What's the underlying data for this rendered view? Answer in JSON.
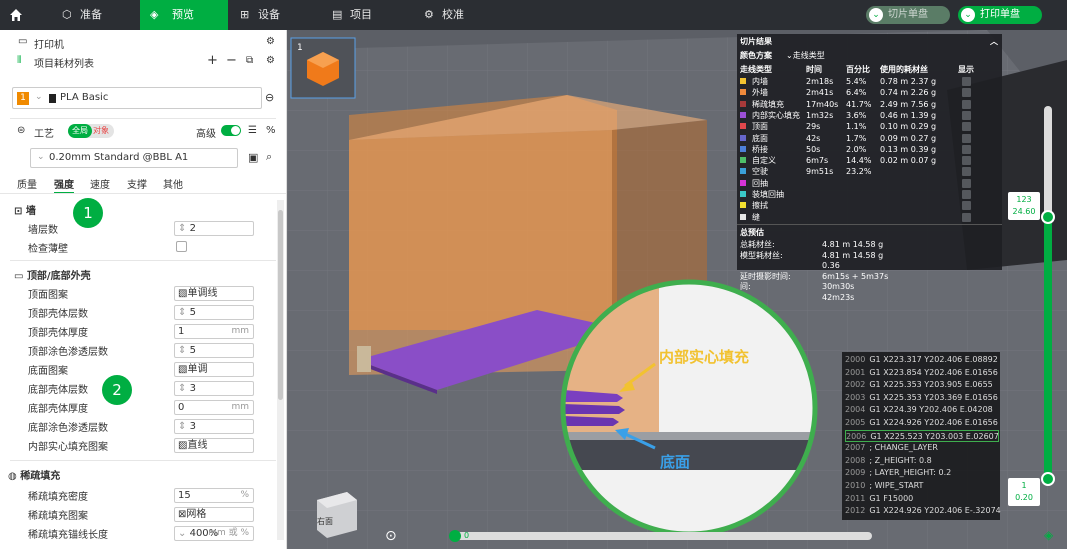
{
  "topbar": {
    "tabs": [
      "准备",
      "预览",
      "设备",
      "项目",
      "校准"
    ],
    "slice_plate": "切片单盘",
    "print_plate": "打印单盘"
  },
  "printer": {
    "label": "打印机",
    "filament_list": "项目耗材列表",
    "filament_slot": "1",
    "filament_name": "PLA Basic"
  },
  "process": {
    "label": "工艺",
    "tag_global": "全局",
    "tag_object": "对象",
    "advanced": "高级",
    "preset": "0.20mm Standard @BBL A1"
  },
  "settings_tabs": [
    "质量",
    "强度",
    "速度",
    "支撑",
    "其他"
  ],
  "sections": {
    "wall": "墙",
    "top_bottom": "顶部/底部外壳",
    "sparse": "稀疏填充"
  },
  "rows": [
    {
      "label": "墙层数",
      "value": "2",
      "unit": ""
    },
    {
      "label": "检查薄壁",
      "value": "",
      "unit": ""
    },
    {
      "label": "顶面图案",
      "value": "单调线",
      "unit": ""
    },
    {
      "label": "顶部壳体层数",
      "value": "5",
      "unit": ""
    },
    {
      "label": "顶部壳体厚度",
      "value": "1",
      "unit": "mm"
    },
    {
      "label": "顶部涂色渗透层数",
      "value": "5",
      "unit": ""
    },
    {
      "label": "底面图案",
      "value": "单调",
      "unit": ""
    },
    {
      "label": "底部壳体层数",
      "value": "3",
      "unit": ""
    },
    {
      "label": "底部壳体厚度",
      "value": "0",
      "unit": "mm"
    },
    {
      "label": "底部涂色渗透层数",
      "value": "3",
      "unit": ""
    },
    {
      "label": "内部实心填充图案",
      "value": "直线",
      "unit": ""
    },
    {
      "label": "稀疏填充密度",
      "value": "15",
      "unit": "%"
    },
    {
      "label": "稀疏填充图案",
      "value": "网格",
      "unit": ""
    },
    {
      "label": "稀疏填充锚线长度",
      "value": "400%",
      "unit": "mm 或 %"
    }
  ],
  "badges": [
    "1",
    "2"
  ],
  "slice_result": {
    "title": "切片结果",
    "scheme_label": "颜色方案",
    "scheme_value": "走线类型",
    "headers": [
      "走线类型",
      "时间",
      "百分比",
      "使用的耗材丝",
      "显示"
    ],
    "lines": [
      {
        "name": "内墙",
        "time": "2m18s",
        "pct": "5.4%",
        "fil": "0.78 m  2.37 g",
        "color": "#f2c230"
      },
      {
        "name": "外墙",
        "time": "2m41s",
        "pct": "6.4%",
        "fil": "0.74 m  2.26 g",
        "color": "#f08a3c"
      },
      {
        "name": "稀疏填充",
        "time": "17m40s",
        "pct": "41.7%",
        "fil": "2.49 m  7.56 g",
        "color": "#a83a3a"
      },
      {
        "name": "内部实心填充",
        "time": "1m32s",
        "pct": "3.6%",
        "fil": "0.46 m  1.39 g",
        "color": "#9b4fd6"
      },
      {
        "name": "顶面",
        "time": "29s",
        "pct": "1.1%",
        "fil": "0.10 m  0.29 g",
        "color": "#e0474c"
      },
      {
        "name": "底面",
        "time": "42s",
        "pct": "1.7%",
        "fil": "0.09 m  0.27 g",
        "color": "#6666cc"
      },
      {
        "name": "桥接",
        "time": "50s",
        "pct": "2.0%",
        "fil": "0.13 m  0.39 g",
        "color": "#4d80d9"
      },
      {
        "name": "自定义",
        "time": "6m7s",
        "pct": "14.4%",
        "fil": "0.02 m  0.07 g",
        "color": "#4fbf6a"
      },
      {
        "name": "空驶",
        "time": "9m51s",
        "pct": "23.2%",
        "fil": "",
        "color": "#3aa0d9"
      },
      {
        "name": "回抽",
        "time": "",
        "pct": "",
        "fil": "",
        "color": "#d633d6"
      },
      {
        "name": "装填回抽",
        "time": "",
        "pct": "",
        "fil": "",
        "color": "#3ac8c8"
      },
      {
        "name": "擦拭",
        "time": "",
        "pct": "",
        "fil": "",
        "color": "#f2e030"
      },
      {
        "name": "缝",
        "time": "",
        "pct": "",
        "fil": "",
        "color": "#e6e6e6"
      }
    ],
    "estimate_title": "总预估",
    "est_rows": [
      {
        "label": "总耗材丝:",
        "value": "4.81 m    14.58 g"
      },
      {
        "label": "模型耗材丝:",
        "value": "4.81 m    14.58 g"
      },
      {
        "label": "",
        "value": "0.36"
      },
      {
        "label": "延时摄影时间:",
        "value": "6m15s + 5m37s"
      },
      {
        "label": "间:",
        "value": "30m30s"
      },
      {
        "label": "",
        "value": "42m23s"
      }
    ]
  },
  "gcode": [
    {
      "n": "2000",
      "t": "G1 X223.317 Y202.406 E.08892"
    },
    {
      "n": "2001",
      "t": "G1 X223.854 Y202.406 E.01656"
    },
    {
      "n": "2002",
      "t": "G1 X225.353 Y203.905 E.0655"
    },
    {
      "n": "2003",
      "t": "G1 X225.353 Y203.369 E.01656"
    },
    {
      "n": "2004",
      "t": "G1 X224.39 Y202.406 E.04208"
    },
    {
      "n": "2005",
      "t": "G1 X224.926 Y202.406 E.01656"
    },
    {
      "n": "2006",
      "t": "G1 X225.523 Y203.003 E.02607"
    },
    {
      "n": "2007",
      "t": "; CHANGE_LAYER"
    },
    {
      "n": "2008",
      "t": "; Z_HEIGHT: 0.8"
    },
    {
      "n": "2009",
      "t": "; LAYER_HEIGHT: 0.2"
    },
    {
      "n": "2010",
      "t": "; WIPE_START"
    },
    {
      "n": "2011",
      "t": "G1 F15000"
    },
    {
      "n": "2012",
      "t": "G1 X224.926 Y202.406 E-.32074"
    }
  ],
  "callouts": {
    "inner": "内部实心填充",
    "bottom": "底面"
  },
  "layer_slider": {
    "top_layer": "123",
    "top_height": "24.60",
    "bottom_layer": "1",
    "bottom_height": "0.20"
  },
  "move_slider": {
    "value": "0"
  },
  "plate_number": "1",
  "view_cube_front": "右面",
  "colors": {
    "accent": "#00ae42",
    "topbar": "#2b2e33",
    "model": "#f5a05a"
  }
}
